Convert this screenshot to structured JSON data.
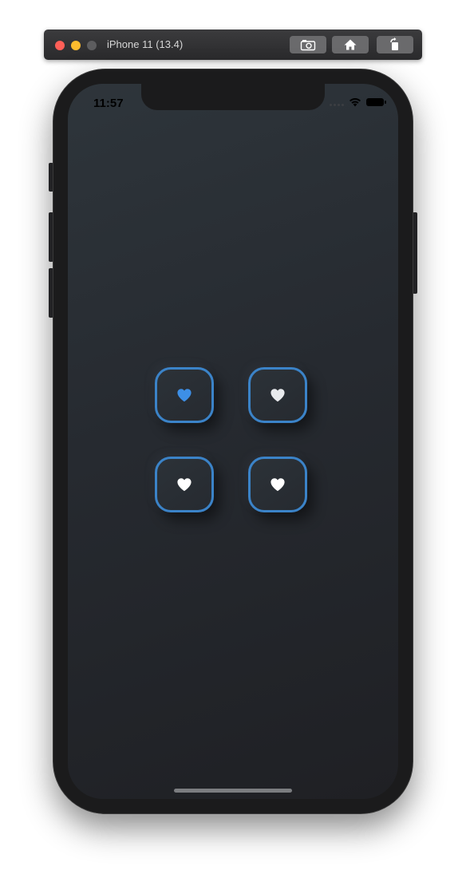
{
  "simulator": {
    "title": "iPhone 11 (13.4)",
    "buttons": {
      "screenshot_icon": "camera-icon",
      "home_icon": "home-icon",
      "rotate_icon": "rotate-icon"
    }
  },
  "status_bar": {
    "time": "11:57",
    "icons": [
      "signal-icon",
      "wifi-icon",
      "battery-icon"
    ]
  },
  "heart_buttons": [
    {
      "icon": "heart-icon",
      "selected": true,
      "heart_color": "#3d8fe6"
    },
    {
      "icon": "heart-icon",
      "selected": false,
      "heart_color": "#e8eaed"
    },
    {
      "icon": "heart-icon",
      "selected": false,
      "heart_color": "#ffffff"
    },
    {
      "icon": "heart-icon",
      "selected": false,
      "heart_color": "#ffffff"
    }
  ],
  "colors": {
    "accent_border": "#3b83c8",
    "background_top": "#2e353b",
    "background_bottom": "#1f2024",
    "selected_heart": "#3d8fe6",
    "unselected_heart": "#ffffff"
  }
}
